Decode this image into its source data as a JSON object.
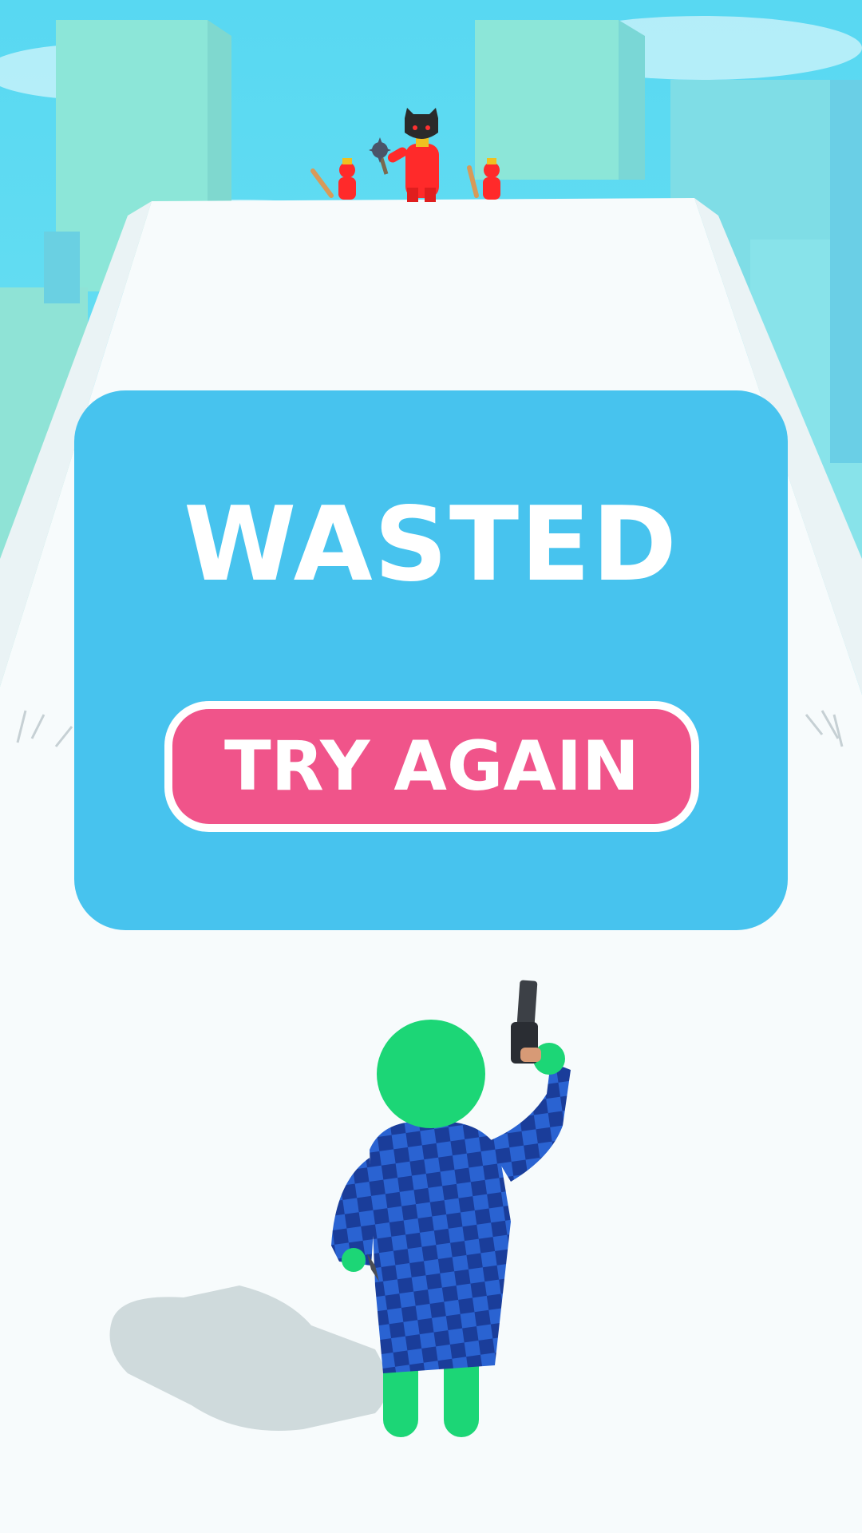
{
  "game_over_dialog": {
    "title": "WASTED",
    "button_label": "TRY AGAIN"
  },
  "colors": {
    "sky": "#5fdff4",
    "dialog_bg": "#47c3ee",
    "button_bg": "#f0548a",
    "track": "#f7fbfc",
    "enemy": "#ff2a2a",
    "player_skin": "#1cd676",
    "player_coat_dark": "#16317a",
    "player_coat_light": "#1f55c4"
  },
  "scene_objects": {
    "boss": "boss-enemy-with-mace",
    "minions": [
      "minion-enemy-left",
      "minion-enemy-right"
    ],
    "player": "player-character-with-pistol"
  }
}
